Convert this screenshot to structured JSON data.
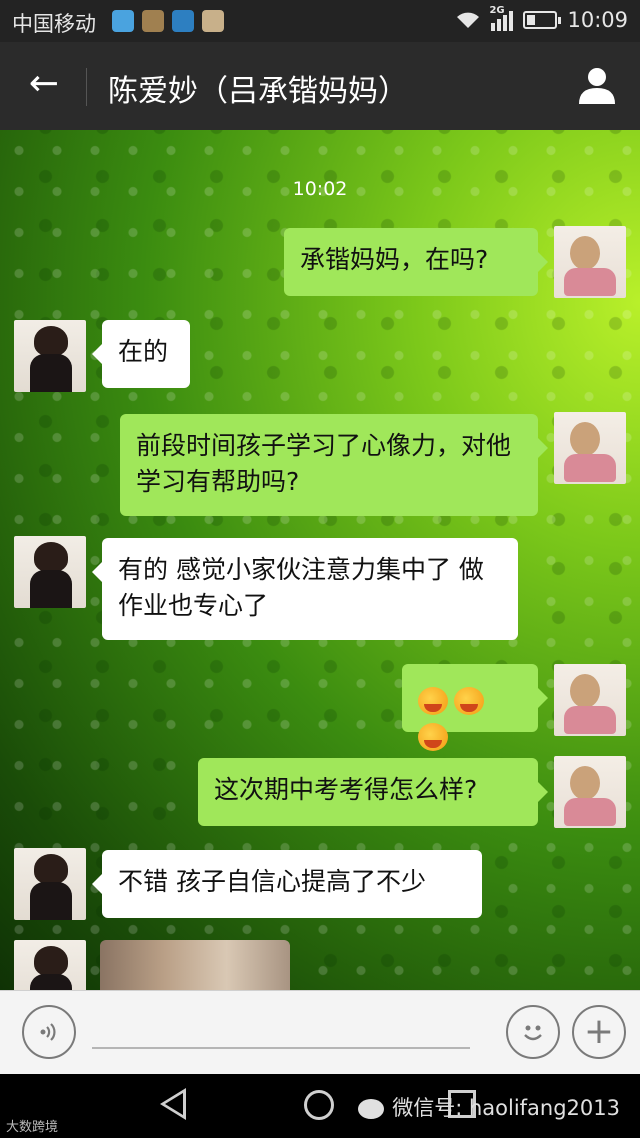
{
  "status_bar": {
    "carrier": "中国移动",
    "network_badge": "2G",
    "time": "10:09",
    "battery_level": 0.3,
    "app_icon_colors": [
      "#4aa3df",
      "#a08050",
      "#2d7fc1",
      "#c8b08a"
    ]
  },
  "title_bar": {
    "title": "陈爱妙（吕承锴妈妈）",
    "back_icon": "back-arrow-icon",
    "profile_icon": "person-icon"
  },
  "chat": {
    "timestamp": "10:02",
    "messages": [
      {
        "side": "right",
        "text": "承锴妈妈，在吗?"
      },
      {
        "side": "left",
        "text": "在的"
      },
      {
        "side": "right",
        "text": "前段时间孩子学习了心像力，对他学习有帮助吗?"
      },
      {
        "side": "left",
        "text": "有的 感觉小家伙注意力集中了 做作业也专心了"
      },
      {
        "side": "right",
        "emoji_count": 3,
        "emoji": "grinning-hands-emoji"
      },
      {
        "side": "right",
        "text": "这次期中考考得怎么样?"
      },
      {
        "side": "left",
        "text": "不错 孩子自信心提高了不少"
      },
      {
        "side": "left",
        "image": "photo-message"
      }
    ],
    "colors": {
      "sent_bubble": "#a0e75a",
      "received_bubble": "#ffffff"
    }
  },
  "input_bar": {
    "voice_icon": "voice-icon",
    "emoji_icon": "emoji-icon",
    "plus_icon": "plus-icon"
  },
  "nav_bar": {
    "watermark_text": "微信号: haolifang2013",
    "corner_mark": "大数跨境"
  }
}
